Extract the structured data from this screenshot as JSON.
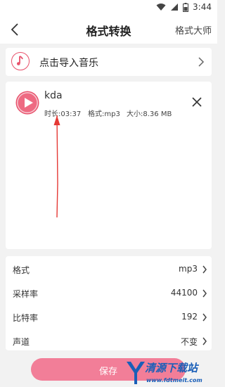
{
  "status_bar": {
    "time": "3:44"
  },
  "app_bar": {
    "title": "格式转换",
    "action": "格式大师"
  },
  "import": {
    "label": "点击导入音乐"
  },
  "file": {
    "name": "kda",
    "duration": "时长:03:37",
    "format": "格式:mp3",
    "size": "大小:8.36 MB"
  },
  "settings": [
    {
      "label": "格式",
      "value": "mp3"
    },
    {
      "label": "采样率",
      "value": "44100"
    },
    {
      "label": "比特率",
      "value": "192"
    },
    {
      "label": "声道",
      "value": "不变"
    }
  ],
  "save": {
    "label": "保存"
  },
  "watermark": {
    "text": "清源下载站",
    "url": "www.fdtmeit.com"
  },
  "colors": {
    "accent": "#e8506a",
    "save_button": "#f27e98",
    "background": "#f2f2f2"
  }
}
